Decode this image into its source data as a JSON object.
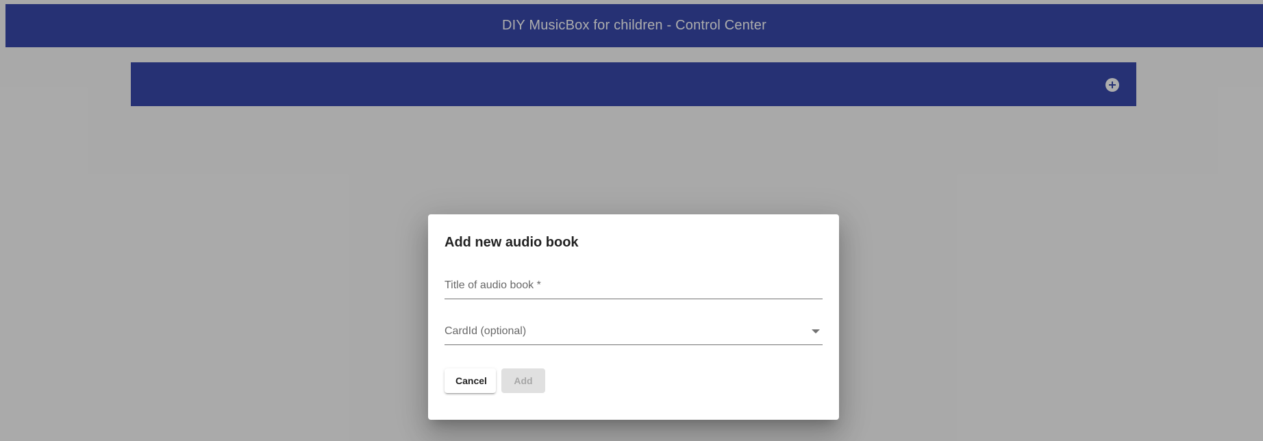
{
  "colors": {
    "primary": "#3949ab",
    "header_text": "#ffffff",
    "page_bg": "#fafafa"
  },
  "header": {
    "title": "DIY MusicBox for children - Control Center"
  },
  "toolbar": {
    "add_icon": "add-circle-icon"
  },
  "dialog": {
    "title": "Add new audio book",
    "title_field": {
      "label": "Title of audio book *",
      "value": ""
    },
    "card_field": {
      "label": "CardId (optional)",
      "value": ""
    },
    "cancel_label": "Cancel",
    "add_label": "Add"
  }
}
